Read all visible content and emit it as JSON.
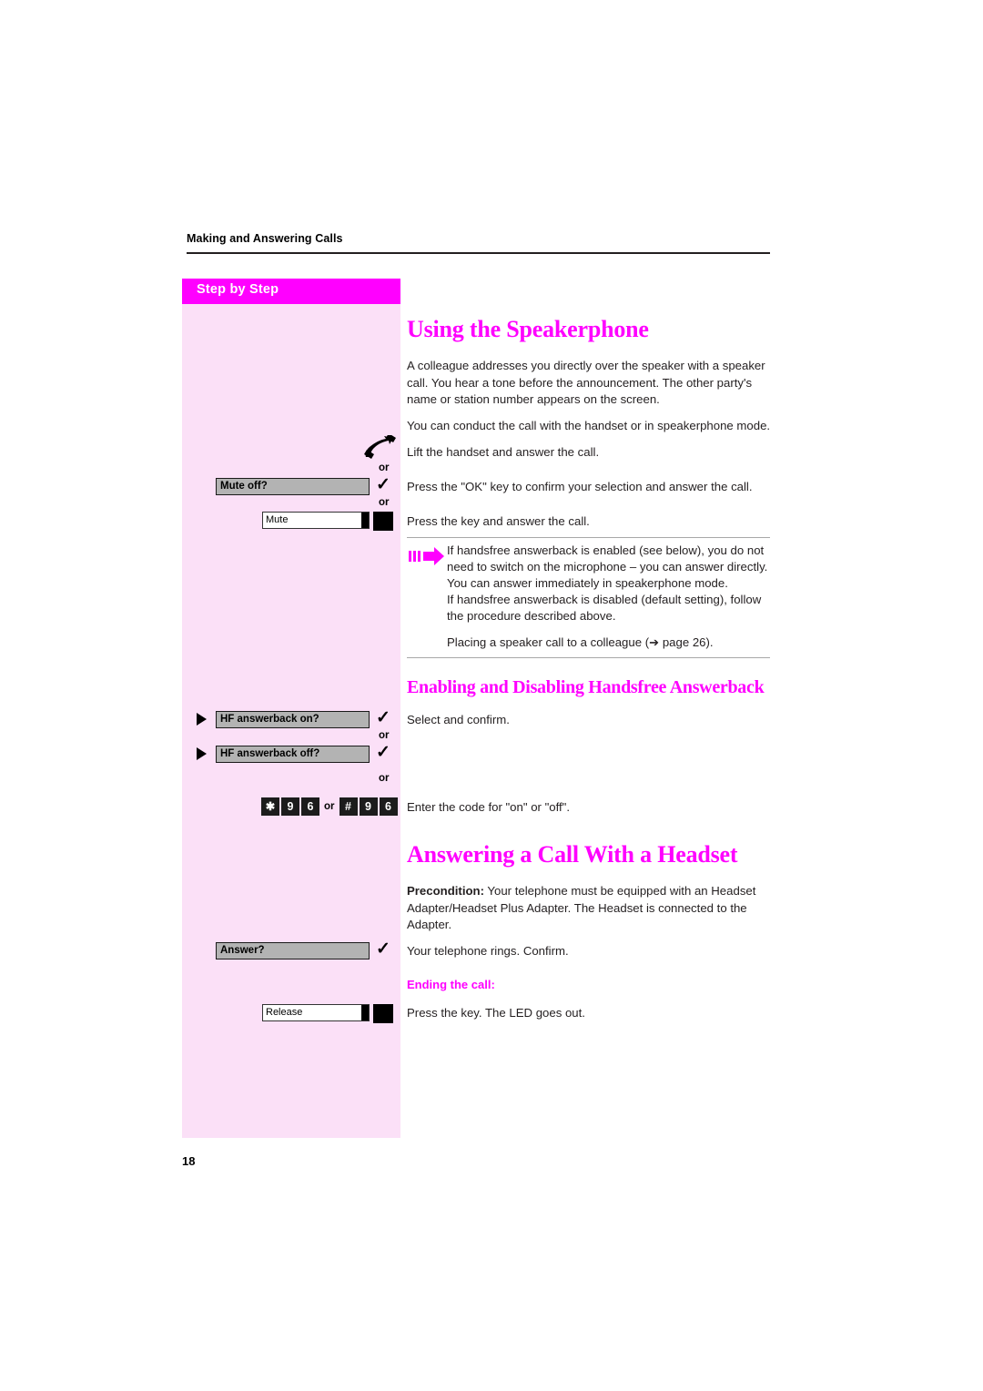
{
  "document": {
    "running_head": "Making and Answering Calls",
    "page_number": "18"
  },
  "sidebar": {
    "header_label": "Step by Step",
    "background_color": "#fbe0f7",
    "header_color": "#ff00ff",
    "widgets": {
      "handset_icon": "handset-lifted-icon",
      "or_1": "or",
      "mute_off_display": "Mute off?",
      "check_1": "✓",
      "or_2": "or",
      "mute_key_label": "Mute",
      "hf_on_display": "HF answerback on?",
      "check_2": "✓",
      "or_3": "or",
      "hf_off_display": "HF answerback off?",
      "check_3": "✓",
      "or_4": "or",
      "code_keys_first": [
        "✱",
        "9",
        "6"
      ],
      "code_or": "or",
      "code_keys_second": [
        "#",
        "9",
        "6"
      ],
      "answer_display": "Answer?",
      "check_4": "✓",
      "release_key_label": "Release"
    }
  },
  "main": {
    "section_1": {
      "title": "Using the Speakerphone",
      "paragraph_1": "A colleague addresses you directly over the speaker with a speaker call. You hear a tone before the announcement. The other party's name or station number appears on the screen.",
      "paragraph_2": "You can conduct the call with the handset or in speakerphone mode.",
      "step_1": "Lift the handset and answer the call.",
      "step_2": "Press the \"OK\" key to confirm your selection and answer the call.",
      "step_3": "Press the key and answer the call.",
      "note_icon": "note-arrow-icon",
      "note_line_1": "If handsfree answerback is enabled (see below), you do not",
      "note_line_2": "need to switch on the microphone – you can answer directly.",
      "note_line_3": "You can answer immediately in speakerphone mode.",
      "note_line_4": "If handsfree answerback is disabled (default setting), follow",
      "note_line_5": "the procedure described above.",
      "cross_ref": "Placing a speaker call to a colleague (➔ page 26)."
    },
    "section_2": {
      "title": "Enabling and Disabling Handsfree Answerback",
      "step_1": "Select and confirm.",
      "step_2": "Enter the code for \"on\" or \"off\"."
    },
    "section_3": {
      "title": "Answering a Call With a Headset",
      "precondition_label": "Precondition:",
      "precondition_text": " Your telephone must be equipped with an Headset Adapter/Headset Plus Adapter. The Headset is connected to the Adapter.",
      "step_1": "Your telephone rings. Confirm.",
      "ending_heading": "Ending the call:",
      "step_2": "Press the key. The LED goes out."
    }
  },
  "colors": {
    "accent_magenta": "#ff00ff",
    "sidebar_pink": "#fbe0f7",
    "body_text": "#231f20",
    "rule_gray": "#a8a8a8",
    "display_gray": "#b3b3b3"
  }
}
